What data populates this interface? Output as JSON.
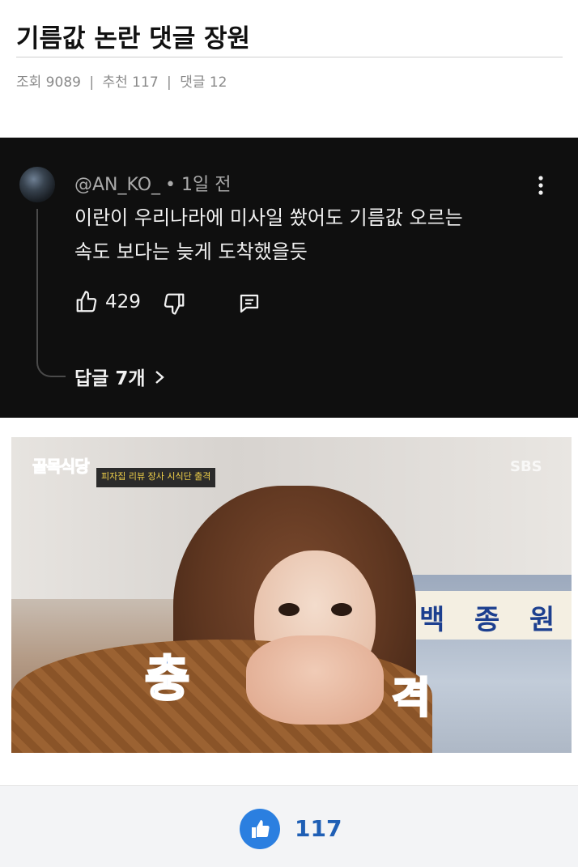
{
  "post": {
    "title": "기름값 논란 댓글 장원",
    "meta": {
      "views_label": "조회 9089",
      "recommend_label": "추천 117",
      "comments_label": "댓글 12",
      "separator": "|"
    }
  },
  "comment": {
    "author": "@AN_KO_",
    "time": "• 1일 전",
    "text_line1": "이란이 우리나라에 미사일 쐈어도 기름값 오르는",
    "text_line2": "속도 보다는 늦게 도착했을듯",
    "like_count": "429",
    "replies_label": "답글 7개",
    "icons": {
      "like": "thumbs-up-icon",
      "dislike": "thumbs-down-icon",
      "reply": "comment-icon",
      "more": "more-vert-icon",
      "replies": "chevron-right-icon"
    }
  },
  "image": {
    "show_logo": "골목식당",
    "broadcaster": "SBS",
    "caption_tag": "피자집 리뷰 장사 시식단 출격",
    "sign_chars": [
      "백",
      "종",
      "원"
    ],
    "shock_left": "충",
    "shock_right": "격"
  },
  "footer": {
    "upvote_count": "117",
    "icon": "thumbs-up-icon"
  },
  "colors": {
    "comment_bg": "#0f0f0f",
    "accent_blue": "#2b7fe0",
    "count_blue": "#1f5fb5"
  }
}
